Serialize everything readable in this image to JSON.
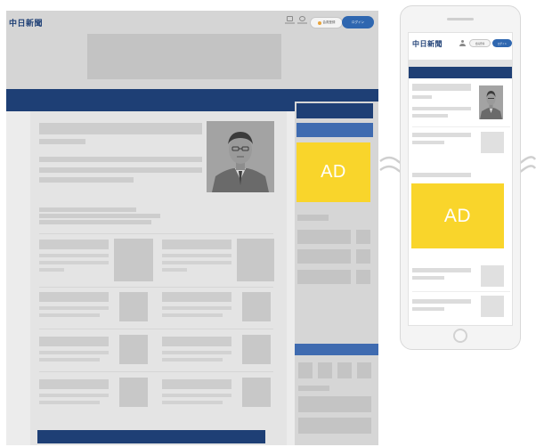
{
  "brand": {
    "logo_text": "中日新聞",
    "colors": {
      "navy": "#1e3f75",
      "blue": "#3f6bb0",
      "login_blue": "#2f67b0",
      "ad_yellow": "#f9d52b"
    }
  },
  "desktop": {
    "header": {
      "logo": "中日新聞",
      "icon_1": "newspaper-icon",
      "icon_2": "search-icon",
      "register_label": "会員登録",
      "login_label": "ログイン"
    },
    "ad": {
      "label": "AD"
    }
  },
  "mobile": {
    "header": {
      "logo": "中日新聞",
      "person_icon": "person-icon",
      "register_label": "会員登録",
      "login_label": "ログイン"
    },
    "ad": {
      "label": "AD"
    }
  },
  "separator": {
    "icon": "wave-break-icon"
  }
}
